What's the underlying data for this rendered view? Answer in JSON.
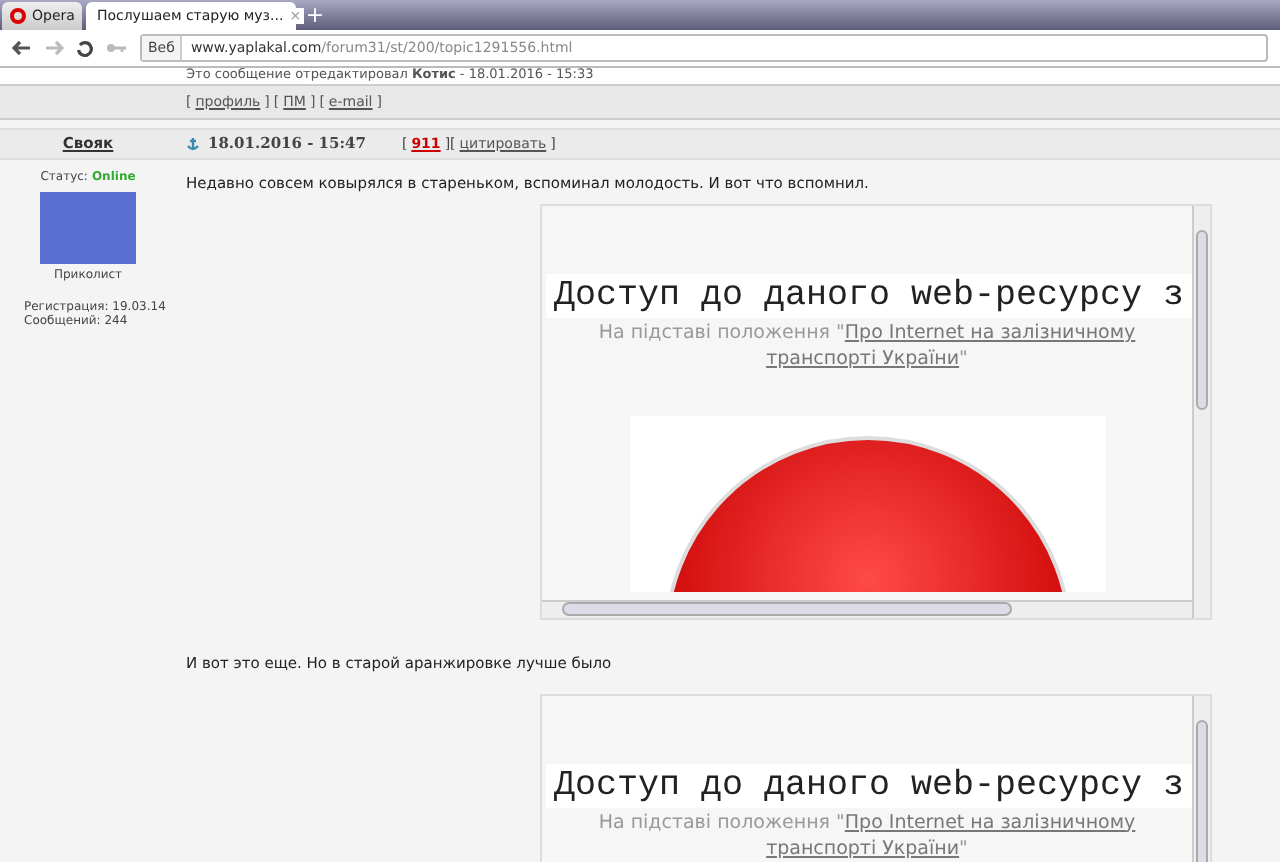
{
  "browser": {
    "menu_button": "Opera",
    "tabs": [
      {
        "title": "Послушаем старую муз...",
        "selected": true,
        "close": "×"
      }
    ],
    "new_tab": "+",
    "address": {
      "badge": "Веб",
      "domain": "www.yaplakal.com",
      "path": "/forum31/st/200/topic1291556.html"
    }
  },
  "edit_note": {
    "text": "Это сообщение отредактировал",
    "author": "Котис",
    "date": " - 18.01.2016 - 15:33"
  },
  "prev_links": [
    {
      "before": "[",
      "text": "профиль",
      "after": "]"
    },
    {
      "before": "[",
      "text": "ПМ",
      "after": "]"
    },
    {
      "before": "[",
      "text": "e-mail",
      "after": "]"
    }
  ],
  "post": {
    "author": "Свояк",
    "status_label": "Статус:",
    "status": "Online",
    "online": true,
    "rank": "Приколист",
    "registered": "Регистрация: 19.03.14",
    "messages": "Сообщений: 244",
    "date": "18.01.2016 - 15:47",
    "rating_before": "[",
    "rating": "911",
    "between": "][",
    "quote": "цитировать",
    "quote_after": "]",
    "blocks": [
      {
        "kind": "text",
        "text": "Недавно совсем ковырялся в стареньком, вспоминал молодость. И вот что вспомнил."
      },
      {
        "kind": "frame",
        "heading": "Доступ до даного web-ресурсу з",
        "prefix": "На підставі положення \"",
        "link_lines": [
          "Про Internet на залізничному",
          "транспорті України"
        ],
        "suffix": "\"",
        "image": true
      },
      {
        "kind": "text",
        "text": "И вот это еще. Но в старой аранжировке лучше было"
      },
      {
        "kind": "frame",
        "heading": "Доступ до даного web-ресурсу з",
        "prefix": "На підставі положення \"",
        "link_lines": [
          "Про Internet на залізничному",
          "транспорті України"
        ],
        "suffix": "\""
      }
    ]
  }
}
